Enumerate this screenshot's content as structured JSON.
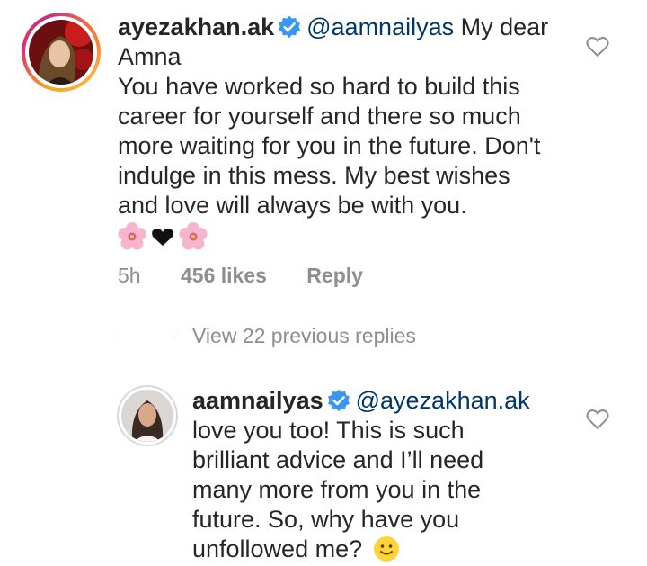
{
  "comment": {
    "username": "ayezakhan.ak",
    "mention": "@aamnailyas",
    "text_lines": [
      "My dear",
      "Amna",
      "You have worked so hard to build this",
      "career for yourself and there so much",
      "more waiting for you in the future. Don't",
      "indulge in this mess. My best wishes",
      "and love will always be with you."
    ],
    "time": "5h",
    "likes": "456 likes",
    "reply": "Reply"
  },
  "view_replies": "View 22 previous replies",
  "reply": {
    "username": "aamnailyas",
    "mention": "@ayezakhan.ak",
    "text_lines": [
      "love you too! This is such",
      "brilliant advice and I’ll need",
      "many more from you in the",
      "future. So, why have you",
      "unfollowed me?"
    ]
  },
  "colors": {
    "text": "#262626",
    "mention": "#00376b",
    "muted": "#8e8e8e",
    "verified": "#3897f0"
  },
  "icons": [
    "verified-badge-icon",
    "heart-icon",
    "cherry-blossom-emoji",
    "black-heart-emoji",
    "smile-emoji"
  ]
}
